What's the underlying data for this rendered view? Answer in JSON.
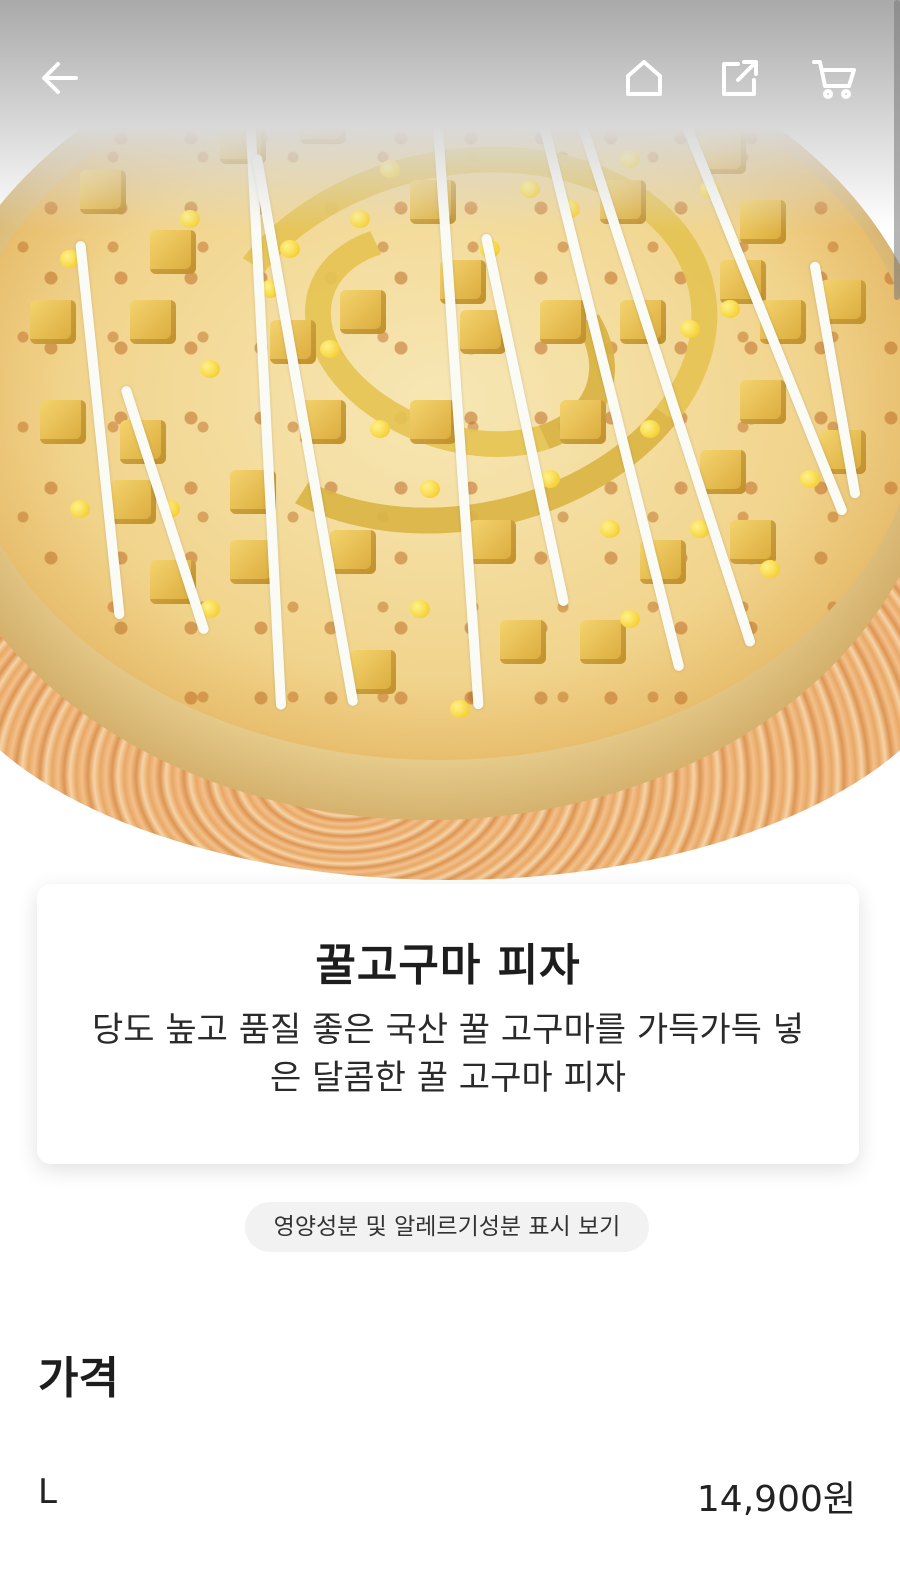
{
  "header": {
    "back_icon": "arrow-left-icon",
    "home_icon": "home-icon",
    "share_icon": "share-icon",
    "cart_icon": "cart-icon"
  },
  "product": {
    "name": "꿀고구마 피자",
    "description": "당도 높고 품질 좋은 국산 꿀 고구마를 가득가득 넣은 달콤한 꿀 고구마 피자"
  },
  "nutrition_button": "영양성분 및 알레르기성분 표시 보기",
  "price": {
    "heading": "가격",
    "options": [
      {
        "size": "L",
        "price": "14,900원"
      }
    ]
  }
}
